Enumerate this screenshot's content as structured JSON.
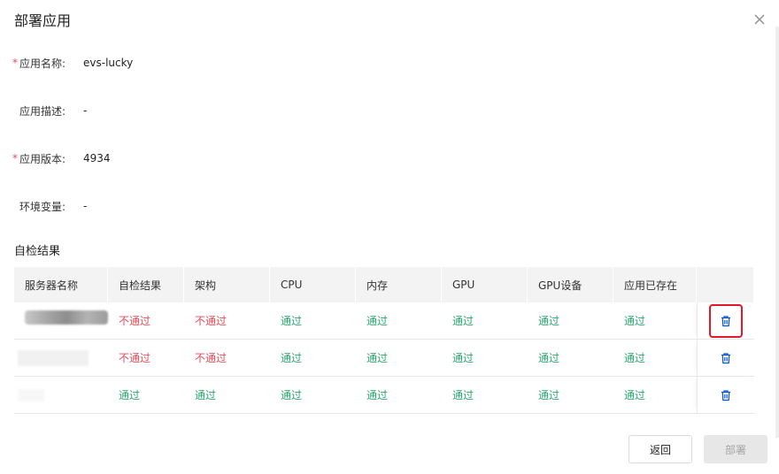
{
  "dialog": {
    "title": "部署应用"
  },
  "form": {
    "app_name": {
      "label": "应用名称:",
      "value": "evs-lucky",
      "required": true
    },
    "app_desc": {
      "label": "应用描述:",
      "value": "-",
      "required": false
    },
    "app_version": {
      "label": "应用版本:",
      "value": "4934",
      "required": true
    },
    "env_vars": {
      "label": "环境变量:",
      "value": "-",
      "required": false
    },
    "required_mark": "*"
  },
  "selfcheck": {
    "title": "自检结果",
    "columns": [
      "服务器名称",
      "自检结果",
      "架构",
      "CPU",
      "内存",
      "GPU",
      "GPU设备",
      "应用已存在"
    ],
    "rows": [
      {
        "server": "",
        "cells": [
          "不通过",
          "不通过",
          "通过",
          "通过",
          "通过",
          "通过",
          "通过"
        ],
        "status": [
          "fail",
          "fail",
          "pass",
          "pass",
          "pass",
          "pass",
          "pass"
        ]
      },
      {
        "server": "",
        "cells": [
          "不通过",
          "不通过",
          "通过",
          "通过",
          "通过",
          "通过",
          "通过"
        ],
        "status": [
          "fail",
          "fail",
          "pass",
          "pass",
          "pass",
          "pass",
          "pass"
        ]
      },
      {
        "server": "",
        "cells": [
          "通过",
          "通过",
          "通过",
          "通过",
          "通过",
          "通过",
          "通过"
        ],
        "status": [
          "pass",
          "pass",
          "pass",
          "pass",
          "pass",
          "pass",
          "pass"
        ]
      }
    ],
    "highlighted_row": 0
  },
  "footer": {
    "back_label": "返回",
    "deploy_label": "部署"
  },
  "icons": {
    "close": "close-icon",
    "delete": "trash-icon"
  },
  "colors": {
    "fail": "#e34d59",
    "pass": "#2ba471",
    "delete_icon": "#0052d9",
    "highlight": "#e0192a"
  }
}
